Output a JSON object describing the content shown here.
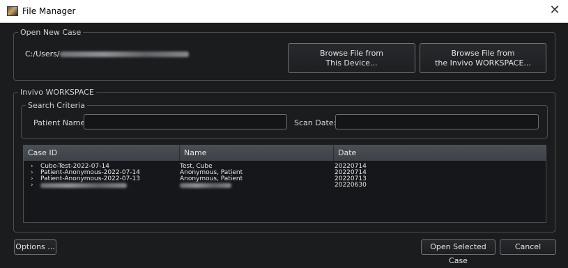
{
  "window": {
    "title": "File Manager",
    "close_glyph": "✕"
  },
  "open_new_case": {
    "legend": "Open New Case",
    "path_prefix": "C:/Users/",
    "browse_device_line1": "Browse File from",
    "browse_device_line2": "This Device...",
    "browse_workspace_line1": "Browse File from",
    "browse_workspace_line2": "the Invivo WORKSPACE..."
  },
  "workspace": {
    "legend": "Invivo WORKSPACE",
    "search": {
      "legend": "Search Criteria",
      "patient_name_label": "Patient Name:",
      "patient_name_value": "",
      "scan_date_label": "Scan Date:",
      "scan_date_value": ""
    },
    "table": {
      "columns": [
        "Case ID",
        "Name",
        "Date"
      ],
      "expand_glyph": "›",
      "rows": [
        {
          "case_id": "Cube-Test-2022-07-14",
          "name": "Test, Cube",
          "date": "20220714"
        },
        {
          "case_id": "Patient-Anonymous-2022-07-14",
          "name": "Anonymous, Patient",
          "date": "20220714"
        },
        {
          "case_id": "Patient-Anonymous-2022-07-13",
          "name": "Anonymous, Patient",
          "date": "20220713"
        },
        {
          "case_id": "",
          "name": "",
          "date": "20220630"
        }
      ]
    }
  },
  "footer": {
    "options_label": "Options ...",
    "open_selected_label": "Open Selected Case",
    "cancel_label": "Cancel"
  },
  "colors": {
    "background": "#1b1c1e",
    "header_gradient_top": "#4a4e55",
    "border": "#6e7278"
  },
  "icons": [
    "app-icon",
    "close-icon",
    "chevron-right-icon"
  ]
}
